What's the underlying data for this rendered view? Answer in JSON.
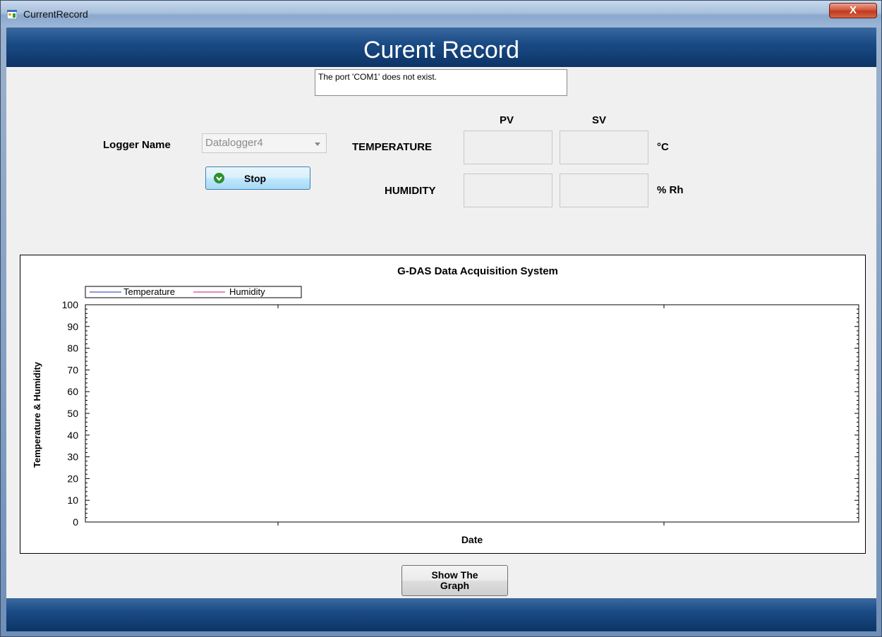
{
  "window": {
    "title": "CurrentRecord",
    "close_glyph": "X"
  },
  "header": {
    "title": "Curent Record"
  },
  "status": {
    "message": "The port 'COM1' does not exist."
  },
  "logger": {
    "label": "Logger Name",
    "selected": "Datalogger4",
    "stop_label": "Stop"
  },
  "readings": {
    "pv_header": "PV",
    "sv_header": "SV",
    "temperature_label": "TEMPERATURE",
    "temperature_unit": "°C",
    "humidity_label": "HUMIDITY",
    "humidity_unit": "% Rh"
  },
  "show_graph": {
    "line1": "Show The",
    "line2": "Graph"
  },
  "chart_data": {
    "type": "line",
    "title": "G-DAS Data Acquisition System",
    "xlabel": "Date",
    "ylabel": "Temperature & Humidity",
    "ylim": [
      0,
      100
    ],
    "yticks": [
      "100",
      "90",
      "80",
      "70",
      "60",
      "50",
      "40",
      "30",
      "20",
      "10",
      "0"
    ],
    "series": [
      {
        "name": "Temperature",
        "color": "#1f2fb8",
        "values": []
      },
      {
        "name": "Humidity",
        "color": "#c21a6b",
        "values": []
      }
    ],
    "legend": "top-left",
    "grid": false
  }
}
